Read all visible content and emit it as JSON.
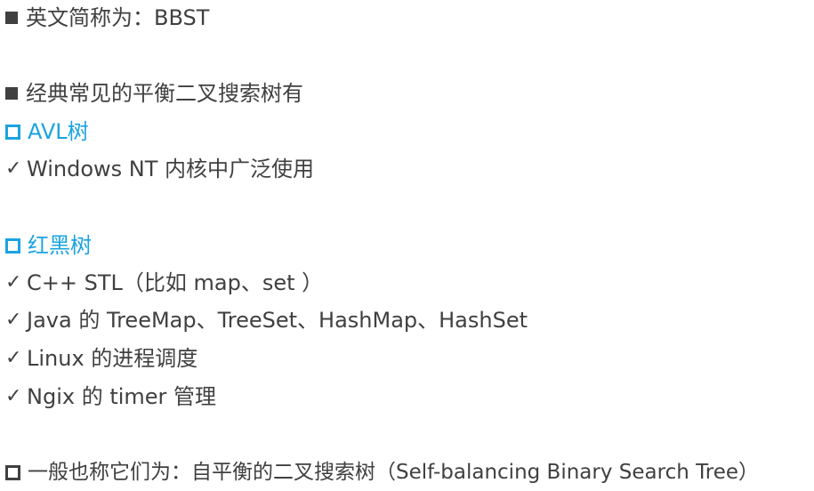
{
  "slide": {
    "line1": "英文简称为：BBST",
    "line2": "经典常见的平衡二叉搜索树有",
    "avl": {
      "title": "AVL树",
      "items": [
        "Windows NT 内核中广泛使用"
      ]
    },
    "rbtree": {
      "title": "红黑树",
      "items": [
        "C++ STL（比如 map、set ）",
        "Java 的 TreeMap、TreeSet、HashMap、HashSet",
        "Linux 的进程调度",
        "Ngix 的 timer 管理"
      ]
    },
    "footer": "一般也称它们为：自平衡的二叉搜索树（Self-balancing Binary Search Tree）",
    "check_glyph": "✓",
    "colors": {
      "text": "#404040",
      "accent": "#1aa3e0"
    }
  }
}
